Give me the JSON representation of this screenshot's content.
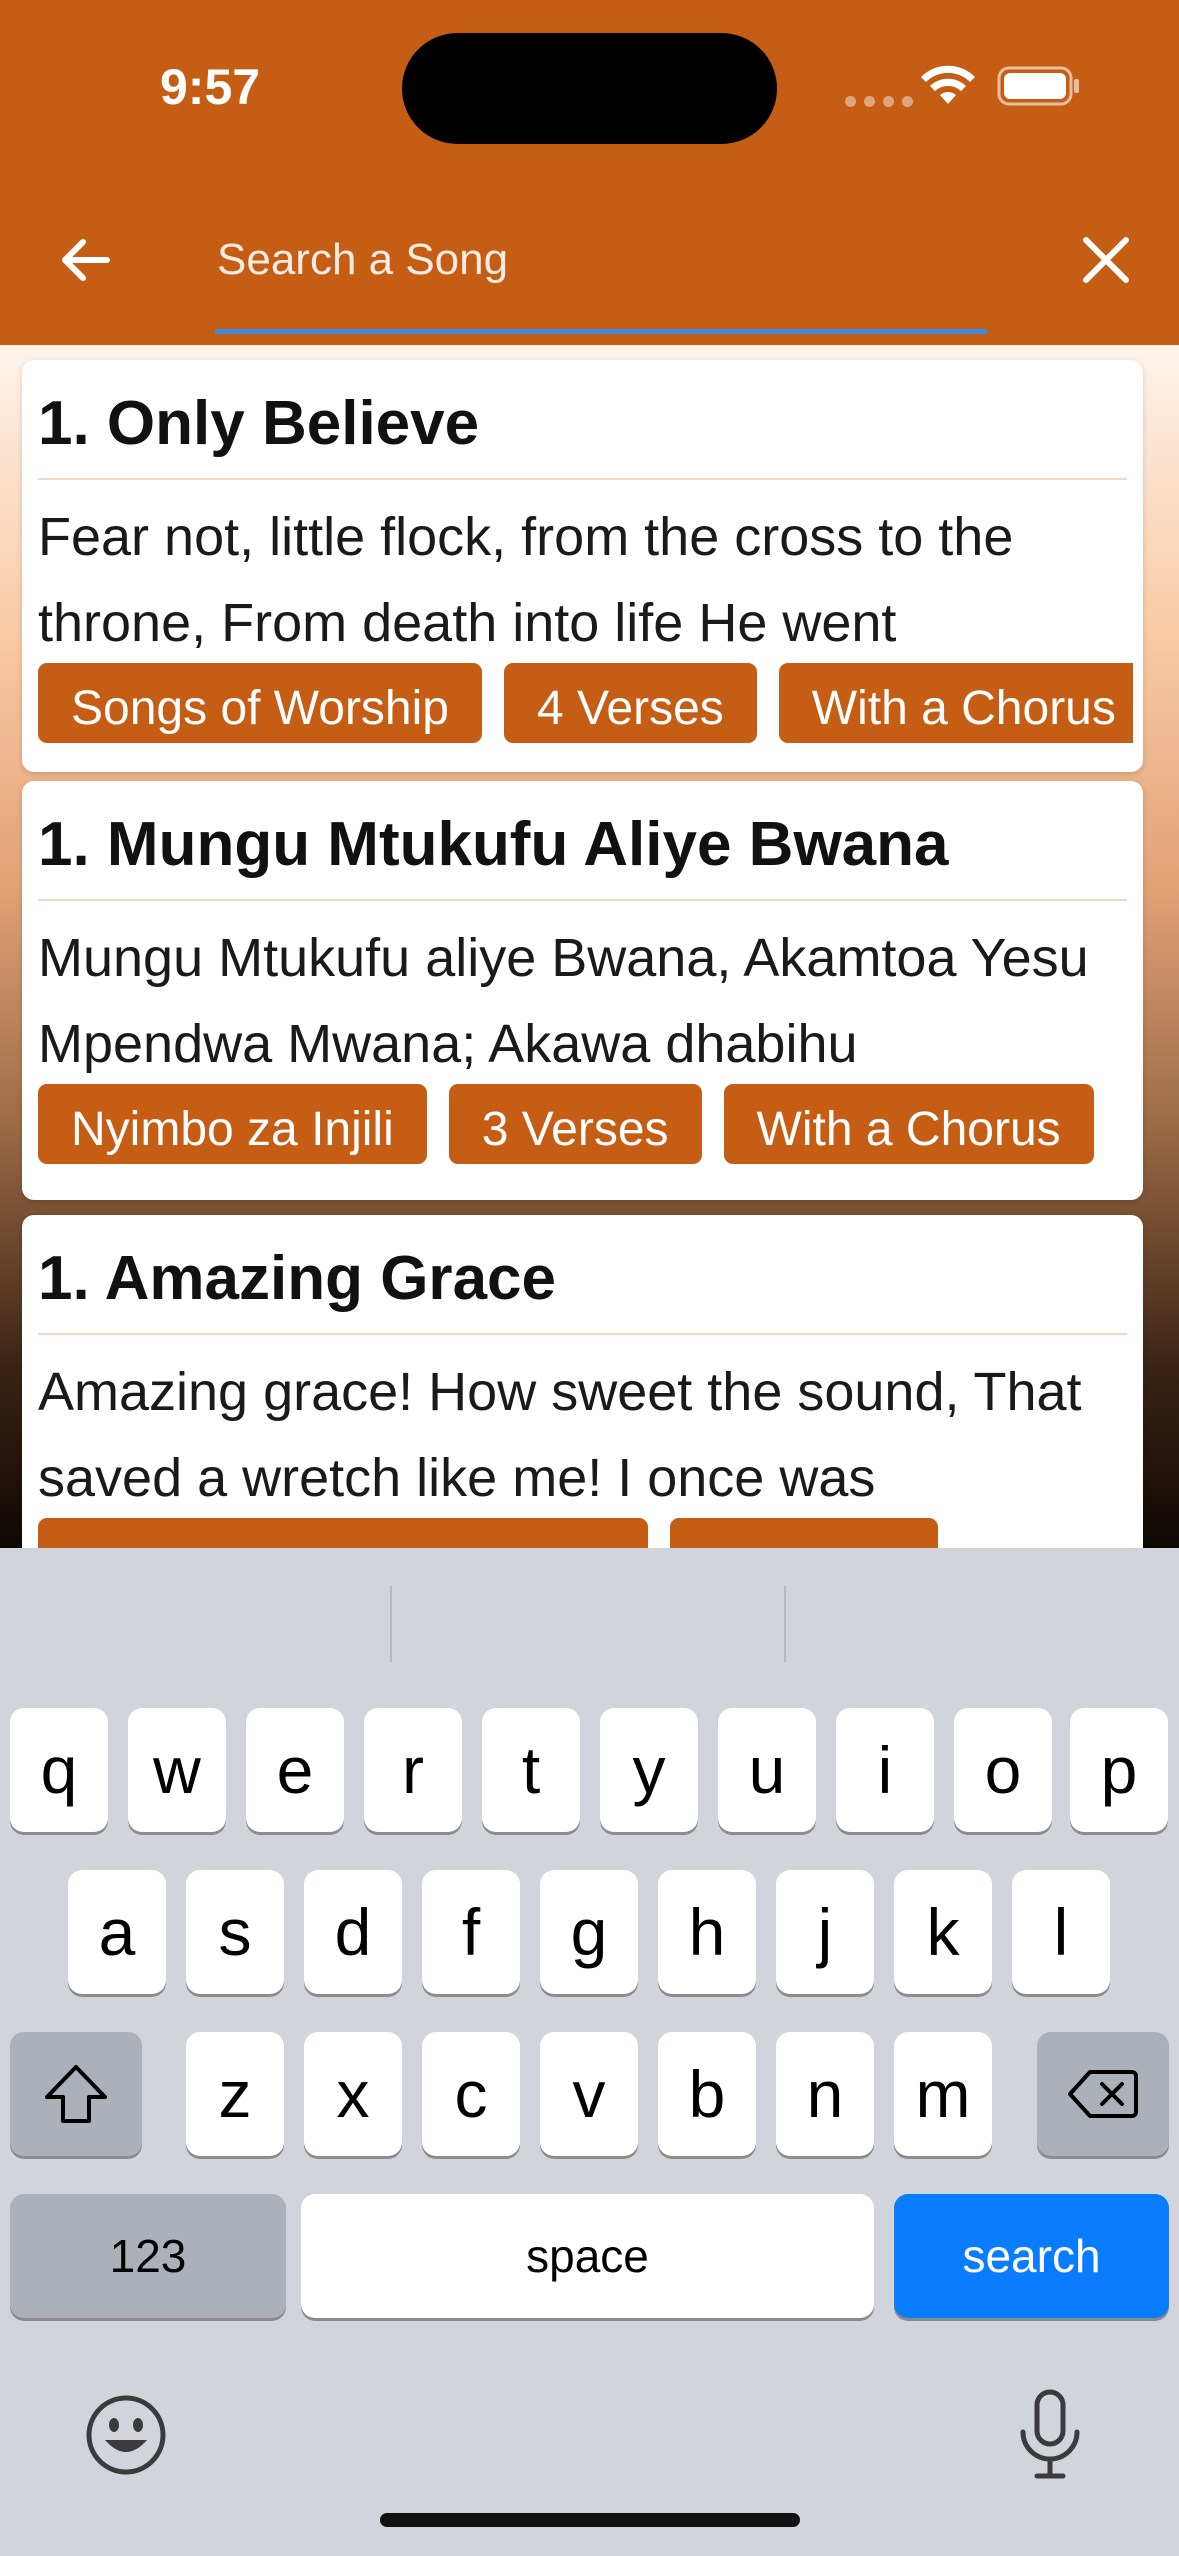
{
  "status_bar": {
    "time": "9:57"
  },
  "search": {
    "placeholder": "Search a Song",
    "value": ""
  },
  "results": [
    {
      "title": "1. Only Believe",
      "excerpt": "Fear not, little flock, from the cross to the throne, From death into life He went",
      "tags": [
        "Songs of Worship",
        "4 Verses",
        "With a Chorus"
      ]
    },
    {
      "title": "1. Mungu Mtukufu Aliye Bwana",
      "excerpt": "Mungu Mtukufu aliye Bwana, Akamtoa Yesu Mpendwa Mwana; Akawa dhabihu",
      "tags": [
        "Nyimbo za Injili",
        "3 Verses",
        "With a Chorus"
      ]
    },
    {
      "title": "1. Amazing Grace",
      "excerpt": "Amazing grace! How sweet the sound, That saved a wretch like me! I once was",
      "tags": [
        "",
        ""
      ]
    }
  ],
  "keyboard": {
    "row1": [
      "q",
      "w",
      "e",
      "r",
      "t",
      "y",
      "u",
      "i",
      "o",
      "p"
    ],
    "row2": [
      "a",
      "s",
      "d",
      "f",
      "g",
      "h",
      "j",
      "k",
      "l"
    ],
    "row3": [
      "z",
      "x",
      "c",
      "v",
      "b",
      "n",
      "m"
    ],
    "numbers_label": "123",
    "space_label": "space",
    "action_label": "search"
  },
  "icons": {
    "back": "arrow-left-icon",
    "close": "close-icon",
    "shift": "shift-icon",
    "delete": "backspace-icon",
    "emoji": "emoji-icon",
    "mic": "microphone-icon",
    "wifi": "wifi-icon",
    "battery": "battery-icon"
  },
  "colors": {
    "accent": "#c55d14",
    "search_underline": "#3d8ae0",
    "keyboard_action": "#0a7cff"
  }
}
